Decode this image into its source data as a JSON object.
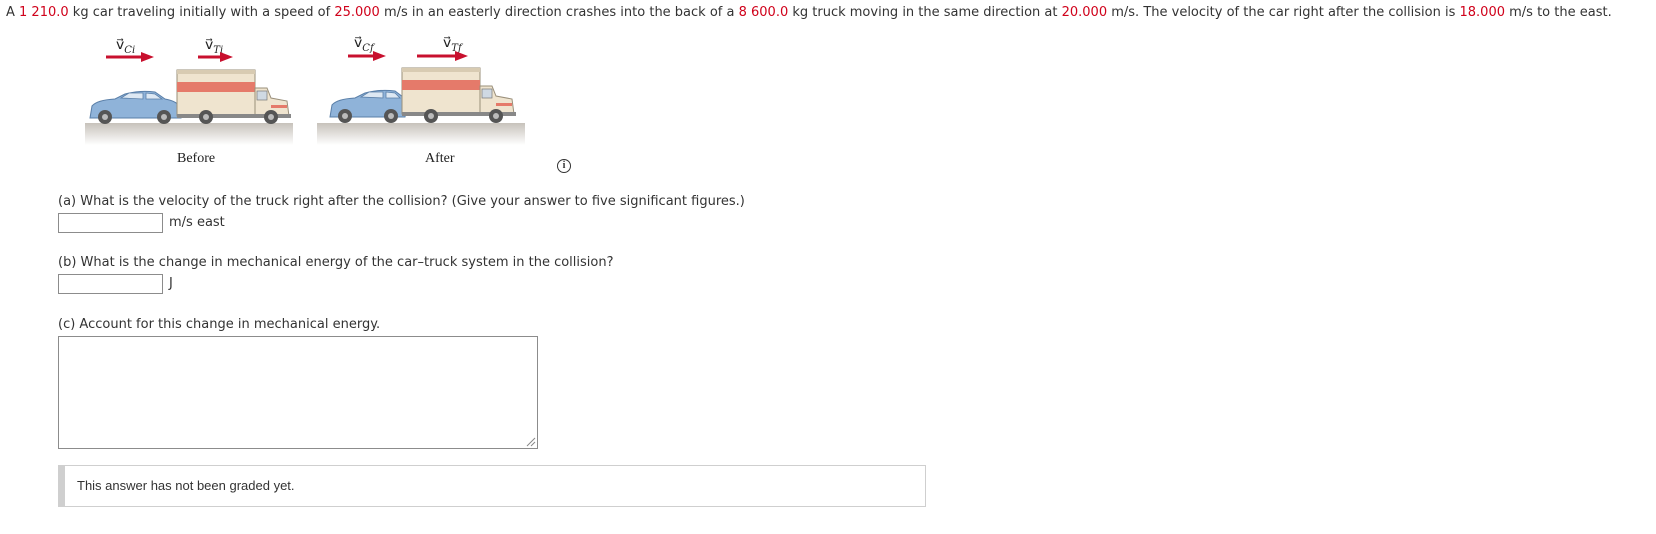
{
  "problem": {
    "p1": "A ",
    "car_mass": "1 210.0",
    "p2": " kg car traveling initially with a speed of ",
    "car_speed": "25.000",
    "p3": " m/s in an easterly direction crashes into the back of a ",
    "truck_mass": "8 600.0",
    "p4": " kg truck moving in the same direction at ",
    "truck_speed": "20.000",
    "p5": " m/s. The velocity of the car right after the collision is ",
    "car_final_speed": "18.000",
    "p6": " m/s to the east."
  },
  "figure": {
    "vec_symbol": "v⃗",
    "sub_ci": "Ci",
    "sub_ti": "Ti",
    "sub_cf": "Cf",
    "sub_tf": "Tf",
    "before_label": "Before",
    "after_label": "After",
    "info_glyph": "i"
  },
  "questions": {
    "a": {
      "text": "(a) What is the velocity of the truck right after the collision? (Give your answer to five significant figures.)",
      "value": "",
      "unit": "m/s east"
    },
    "b": {
      "text": "(b) What is the change in mechanical energy of the car–truck system in the collision?",
      "value": "",
      "unit": "J"
    },
    "c": {
      "text": "(c) Account for this change in mechanical energy.",
      "value": ""
    }
  },
  "status": {
    "text": "This answer has not been graded yet."
  },
  "colors": {
    "highlight": "#d0021b",
    "arrow": "#c8102e",
    "car": "#8fb3d9",
    "truck_stripe": "#e57a6a"
  }
}
